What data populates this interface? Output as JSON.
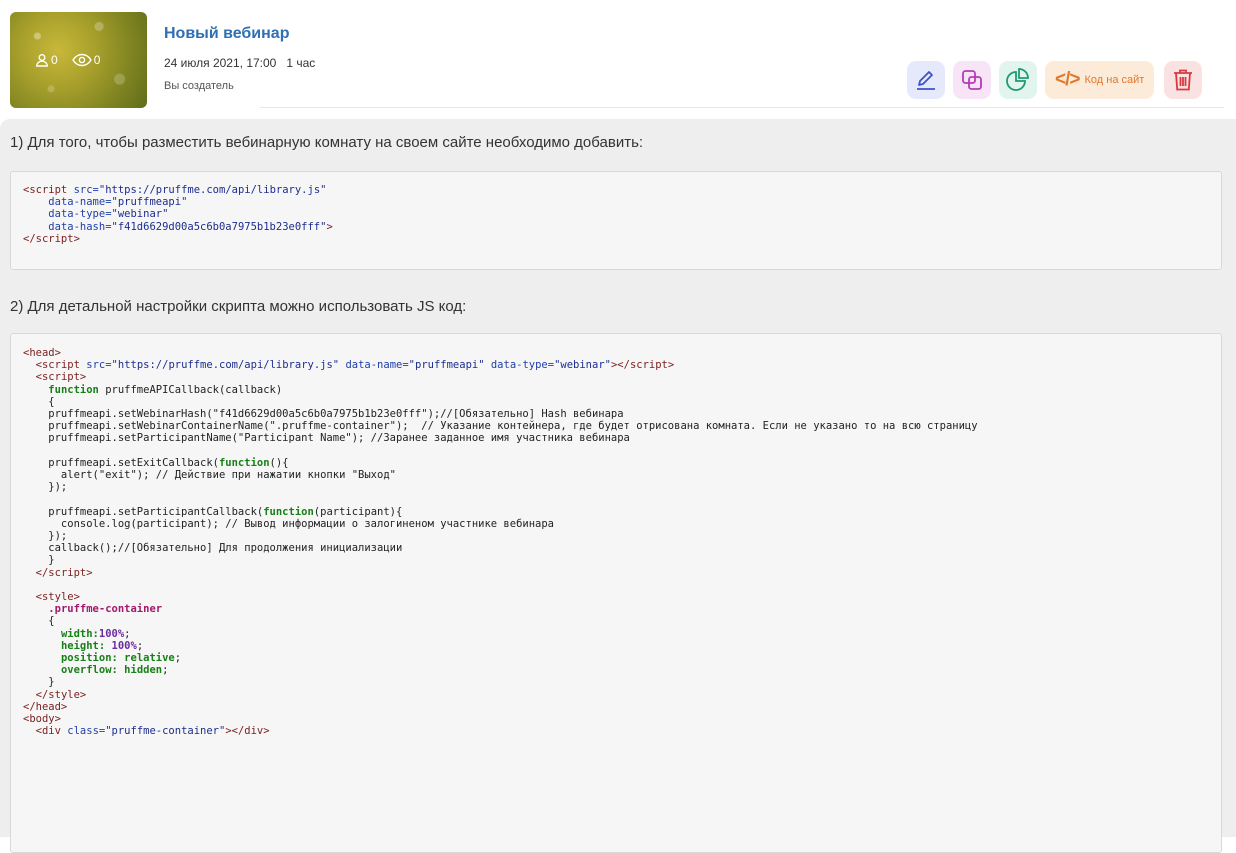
{
  "webinar": {
    "title": "Новый вебинар",
    "date": "24 июля 2021, 17:00",
    "duration": "1 час",
    "creator": "Вы создатель",
    "participants_count": "0",
    "views_count": "0"
  },
  "actions": {
    "edit_icon": "pencil-icon",
    "copy_icon": "copy-icon",
    "stats_icon": "pie-chart-icon",
    "embed_label": "Код на сайт",
    "delete_icon": "trash-icon"
  },
  "colors": {
    "title": "#2f6fb3",
    "edit_bg": "#e6e9fb",
    "copy_bg": "#f7e4f7",
    "stats_bg": "#e2f4ee",
    "embed_bg": "#fdebd9",
    "embed_fg": "#e1782c",
    "delete_bg": "#fbe2e2",
    "delete_fg": "#d9393e"
  },
  "instructions": {
    "step1": "1) Для того, чтобы разместить вебинарную комнату на своем сайте необходимо добавить:",
    "step2": "2) Для детальной настройки скрипта можно использовать JS код:"
  },
  "code1": {
    "src_url": "https://pruffme.com/api/library.js",
    "data_name": "pruffmeapi",
    "data_type": "webinar",
    "data_hash": "f41d6629d00a5c6b0a7975b1b23e0fff"
  },
  "code2": {
    "set_hash_line": "    pruffmeapi.setWebinarHash(\"f41d6629d00a5c6b0a7975b1b23e0fff\");//[Обязательно] Hash вебинара",
    "set_container_line": "    pruffmeapi.setWebinarContainerName(\".pruffme-container\");  // Указание контейнера, где будет отрисована комната. Если не указано то на всю страницу",
    "set_name_line": "    pruffmeapi.setParticipantName(\"Participant Name\"); //Заранее заданное имя участника вебинара",
    "alert_line": "      alert(\"exit\"); // Действие при нажатии кнопки \"Выход\"",
    "console_line": "      console.log(participant); // Вывод информации о залогиненом участнике вебинара",
    "callback_line": "    callback();//[Обязательно] Для продолжения инициализации",
    "container_class": ".pruffme-container"
  }
}
